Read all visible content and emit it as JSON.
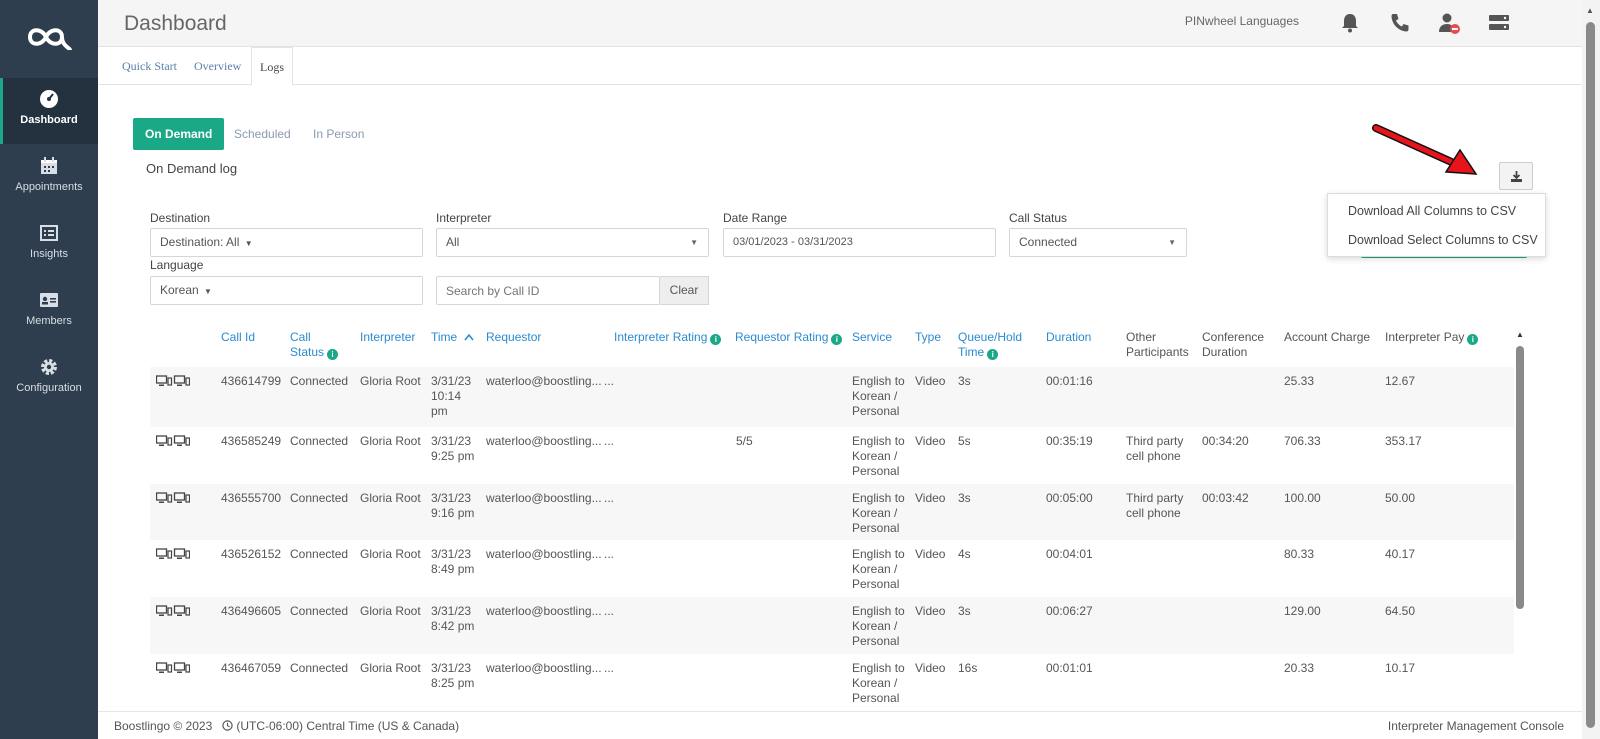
{
  "sidebar": {
    "items": [
      {
        "label": "Dashboard",
        "icon": "speedometer-icon"
      },
      {
        "label": "Appointments",
        "icon": "calendar-icon"
      },
      {
        "label": "Insights",
        "icon": "list-icon"
      },
      {
        "label": "Members",
        "icon": "id-card-icon"
      },
      {
        "label": "Configuration",
        "icon": "gear-icon"
      }
    ]
  },
  "header": {
    "title": "Dashboard",
    "org_name": "PINwheel Languages",
    "icons": [
      "bell-icon",
      "phone-icon",
      "user-status-icon",
      "server-icon"
    ]
  },
  "tabs": [
    "Quick Start",
    "Overview",
    "Logs"
  ],
  "subtabs": [
    "On Demand",
    "Scheduled",
    "In Person"
  ],
  "log_title": "On Demand log",
  "filters": {
    "destination_label": "Destination",
    "destination_value": "Destination: All",
    "interpreter_label": "Interpreter",
    "interpreter_value": "All",
    "date_range_label": "Date Range",
    "date_range_value": "03/01/2023 - 03/31/2023",
    "call_status_label": "Call Status",
    "call_status_value": "Connected",
    "language_label": "Language",
    "language_value": "Korean",
    "search_placeholder": "Search by Call ID",
    "clear_label": "Clear"
  },
  "download_menu": {
    "all": "Download All Columns to CSV",
    "select": "Download Select Columns to CSV"
  },
  "columns": {
    "call_id": "Call Id",
    "call_status_1": "Call",
    "call_status_2": "Status",
    "interpreter": "Interpreter",
    "time": "Time",
    "requestor": "Requestor",
    "interpreter_rating": "Interpreter Rating",
    "requestor_rating": "Requestor Rating",
    "service": "Service",
    "type": "Type",
    "queue_1": "Queue/Hold",
    "queue_2": "Time",
    "duration": "Duration",
    "other_1": "Other",
    "other_2": "Participants",
    "conf_1": "Conference",
    "conf_2": "Duration",
    "account_charge": "Account Charge",
    "interpreter_pay": "Interpreter Pay"
  },
  "rows": [
    {
      "id": "436614799",
      "status": "Connected",
      "interpreter": "Gloria Root",
      "time1": "3/31/23",
      "time2": "10:14",
      "time3": "pm",
      "requestor": "waterloo@boostling...",
      "ir": "...",
      "rr": "",
      "s1": "English to",
      "s2": "Korean /",
      "s3": "Personal",
      "type": "Video",
      "queue": "3s",
      "duration": "00:01:16",
      "o1": "",
      "o2": "",
      "conf": "",
      "charge": "25.33",
      "pay": "12.67"
    },
    {
      "id": "436585249",
      "status": "Connected",
      "interpreter": "Gloria Root",
      "time1": "3/31/23",
      "time2": "9:25 pm",
      "time3": "",
      "requestor": "waterloo@boostling...",
      "ir": "...",
      "rr": "5/5",
      "s1": "English to",
      "s2": "Korean /",
      "s3": "Personal",
      "type": "Video",
      "queue": "5s",
      "duration": "00:35:19",
      "o1": "Third party",
      "o2": "cell phone",
      "conf": "00:34:20",
      "charge": "706.33",
      "pay": "353.17"
    },
    {
      "id": "436555700",
      "status": "Connected",
      "interpreter": "Gloria Root",
      "time1": "3/31/23",
      "time2": "9:16 pm",
      "time3": "",
      "requestor": "waterloo@boostling...",
      "ir": "...",
      "rr": "",
      "s1": "English to",
      "s2": "Korean /",
      "s3": "Personal",
      "type": "Video",
      "queue": "3s",
      "duration": "00:05:00",
      "o1": "Third party",
      "o2": "cell phone",
      "conf": "00:03:42",
      "charge": "100.00",
      "pay": "50.00"
    },
    {
      "id": "436526152",
      "status": "Connected",
      "interpreter": "Gloria Root",
      "time1": "3/31/23",
      "time2": "8:49 pm",
      "time3": "",
      "requestor": "waterloo@boostling...",
      "ir": "...",
      "rr": "",
      "s1": "English to",
      "s2": "Korean /",
      "s3": "Personal",
      "type": "Video",
      "queue": "4s",
      "duration": "00:04:01",
      "o1": "",
      "o2": "",
      "conf": "",
      "charge": "80.33",
      "pay": "40.17"
    },
    {
      "id": "436496605",
      "status": "Connected",
      "interpreter": "Gloria Root",
      "time1": "3/31/23",
      "time2": "8:42 pm",
      "time3": "",
      "requestor": "waterloo@boostling...",
      "ir": "...",
      "rr": "",
      "s1": "English to",
      "s2": "Korean /",
      "s3": "Personal",
      "type": "Video",
      "queue": "3s",
      "duration": "00:06:27",
      "o1": "",
      "o2": "",
      "conf": "",
      "charge": "129.00",
      "pay": "64.50"
    },
    {
      "id": "436467059",
      "status": "Connected",
      "interpreter": "Gloria Root",
      "time1": "3/31/23",
      "time2": "8:25 pm",
      "time3": "",
      "requestor": "waterloo@boostling...",
      "ir": "...",
      "rr": "",
      "s1": "English to",
      "s2": "Korean /",
      "s3": "Personal",
      "type": "Video",
      "queue": "16s",
      "duration": "00:01:01",
      "o1": "",
      "o2": "",
      "conf": "",
      "charge": "20.33",
      "pay": "10.17"
    }
  ],
  "footer": {
    "brand": "Boostlingo © 2023",
    "timezone": "(UTC-06:00) Central Time (US & Canada)",
    "console": "Interpreter Management Console"
  },
  "colors": {
    "sidebar": "#2e3e4e",
    "accent": "#1aa886",
    "link": "#2a8bd0",
    "annotation_arrow": "#e8141b"
  }
}
